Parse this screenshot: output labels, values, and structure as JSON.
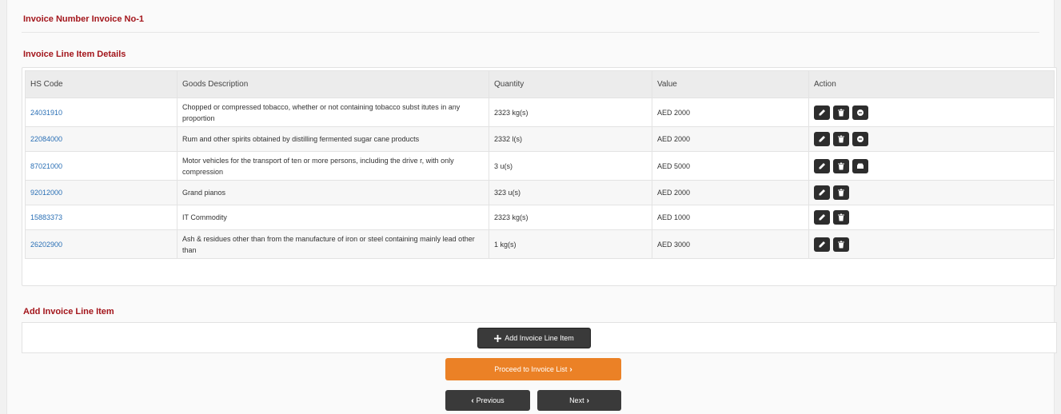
{
  "invoice_title": "Invoice Number Invoice No-1",
  "details_title": "Invoice Line Item Details",
  "table": {
    "headers": [
      "HS Code",
      "Goods Description",
      "Quantity",
      "Value",
      "Action"
    ],
    "rows": [
      {
        "hs": "24031910",
        "desc": "Chopped or compressed tobacco, whether or not containing tobacco subst itutes in any proportion",
        "qty": "2323 kg(s)",
        "value": "AED 2000",
        "actions": [
          "edit-icon",
          "delete-icon",
          "circle-icon"
        ]
      },
      {
        "hs": "22084000",
        "desc": "Rum and other spirits obtained by distilling fermented sugar cane products",
        "qty": "2332 l(s)",
        "value": "AED 2000",
        "actions": [
          "edit-icon",
          "delete-icon",
          "circle-icon"
        ]
      },
      {
        "hs": "87021000",
        "desc": "Motor vehicles for the transport of ten or more persons, including the drive r, with only compression",
        "qty": "3 u(s)",
        "value": "AED 5000",
        "actions": [
          "edit-icon",
          "delete-icon",
          "car-icon"
        ]
      },
      {
        "hs": "92012000",
        "desc": "Grand pianos",
        "qty": "323 u(s)",
        "value": "AED 2000",
        "actions": [
          "edit-icon",
          "delete-icon"
        ]
      },
      {
        "hs": "15883373",
        "desc": "IT Commodity",
        "qty": "2323 kg(s)",
        "value": "AED 1000",
        "actions": [
          "edit-icon",
          "delete-icon"
        ]
      },
      {
        "hs": "26202900",
        "desc": "Ash & residues other than from the manufacture of iron or steel containing mainly lead other than",
        "qty": "1 kg(s)",
        "value": "AED 3000",
        "actions": [
          "edit-icon",
          "delete-icon"
        ]
      }
    ]
  },
  "add_title": "Add Invoice Line Item",
  "add_button": "Add Invoice Line Item",
  "proceed_button": "Proceed to Invoice List",
  "previous_button": "Previous",
  "next_button": "Next",
  "colors": {
    "title": "#a3151b",
    "link": "#2a6fb5",
    "proceed": "#eb8126",
    "dark_button": "#3a3a3a"
  }
}
